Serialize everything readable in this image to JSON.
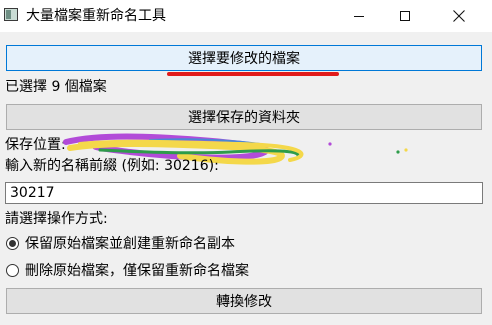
{
  "window": {
    "title": "大量檔案重新命名工具"
  },
  "buttons": {
    "select_files": "選擇要修改的檔案",
    "select_folder": "選擇保存的資料夾",
    "convert": "轉換修改"
  },
  "status": {
    "selected_files": "已選擇 9 個檔案"
  },
  "save_location": {
    "label": "保存位置:"
  },
  "prefix": {
    "label": "輸入新的名稱前綴 (例如: 30216):",
    "value": "30217"
  },
  "operation": {
    "label": "請選擇操作方式:",
    "options": [
      {
        "label": "保留原始檔案並創建重新命名副本",
        "selected": true
      },
      {
        "label": "刪除原始檔案，僅保留重新命名檔案",
        "selected": false
      }
    ]
  }
}
